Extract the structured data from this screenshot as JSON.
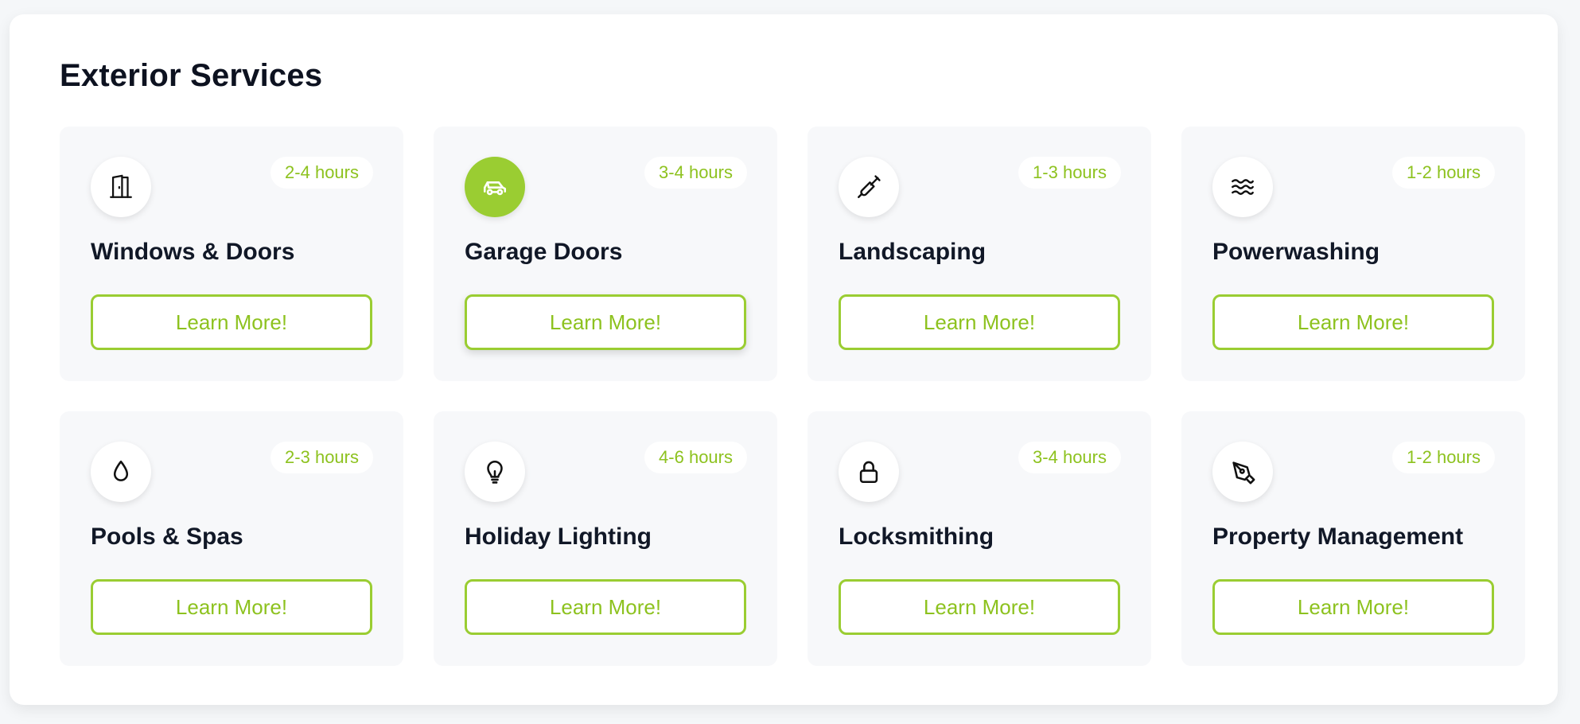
{
  "section": {
    "title": "Exterior Services"
  },
  "theme": {
    "accent": "#9acd32",
    "accent_text": "#8dc21f"
  },
  "services": [
    {
      "name": "Windows & Doors",
      "duration": "2-4 hours",
      "button": "Learn More!",
      "icon": "door-icon"
    },
    {
      "name": "Garage Doors",
      "duration": "3-4 hours",
      "button": "Learn More!",
      "icon": "car-icon"
    },
    {
      "name": "Landscaping",
      "duration": "1-3 hours",
      "button": "Learn More!",
      "icon": "shovel-icon"
    },
    {
      "name": "Powerwashing",
      "duration": "1-2 hours",
      "button": "Learn More!",
      "icon": "waves-icon"
    },
    {
      "name": "Pools & Spas",
      "duration": "2-3 hours",
      "button": "Learn More!",
      "icon": "droplet-icon"
    },
    {
      "name": "Holiday Lighting",
      "duration": "4-6 hours",
      "button": "Learn More!",
      "icon": "lightbulb-icon"
    },
    {
      "name": "Locksmithing",
      "duration": "3-4 hours",
      "button": "Learn More!",
      "icon": "lock-icon"
    },
    {
      "name": "Property Management",
      "duration": "1-2 hours",
      "button": "Learn More!",
      "icon": "pen-tool-icon"
    }
  ]
}
